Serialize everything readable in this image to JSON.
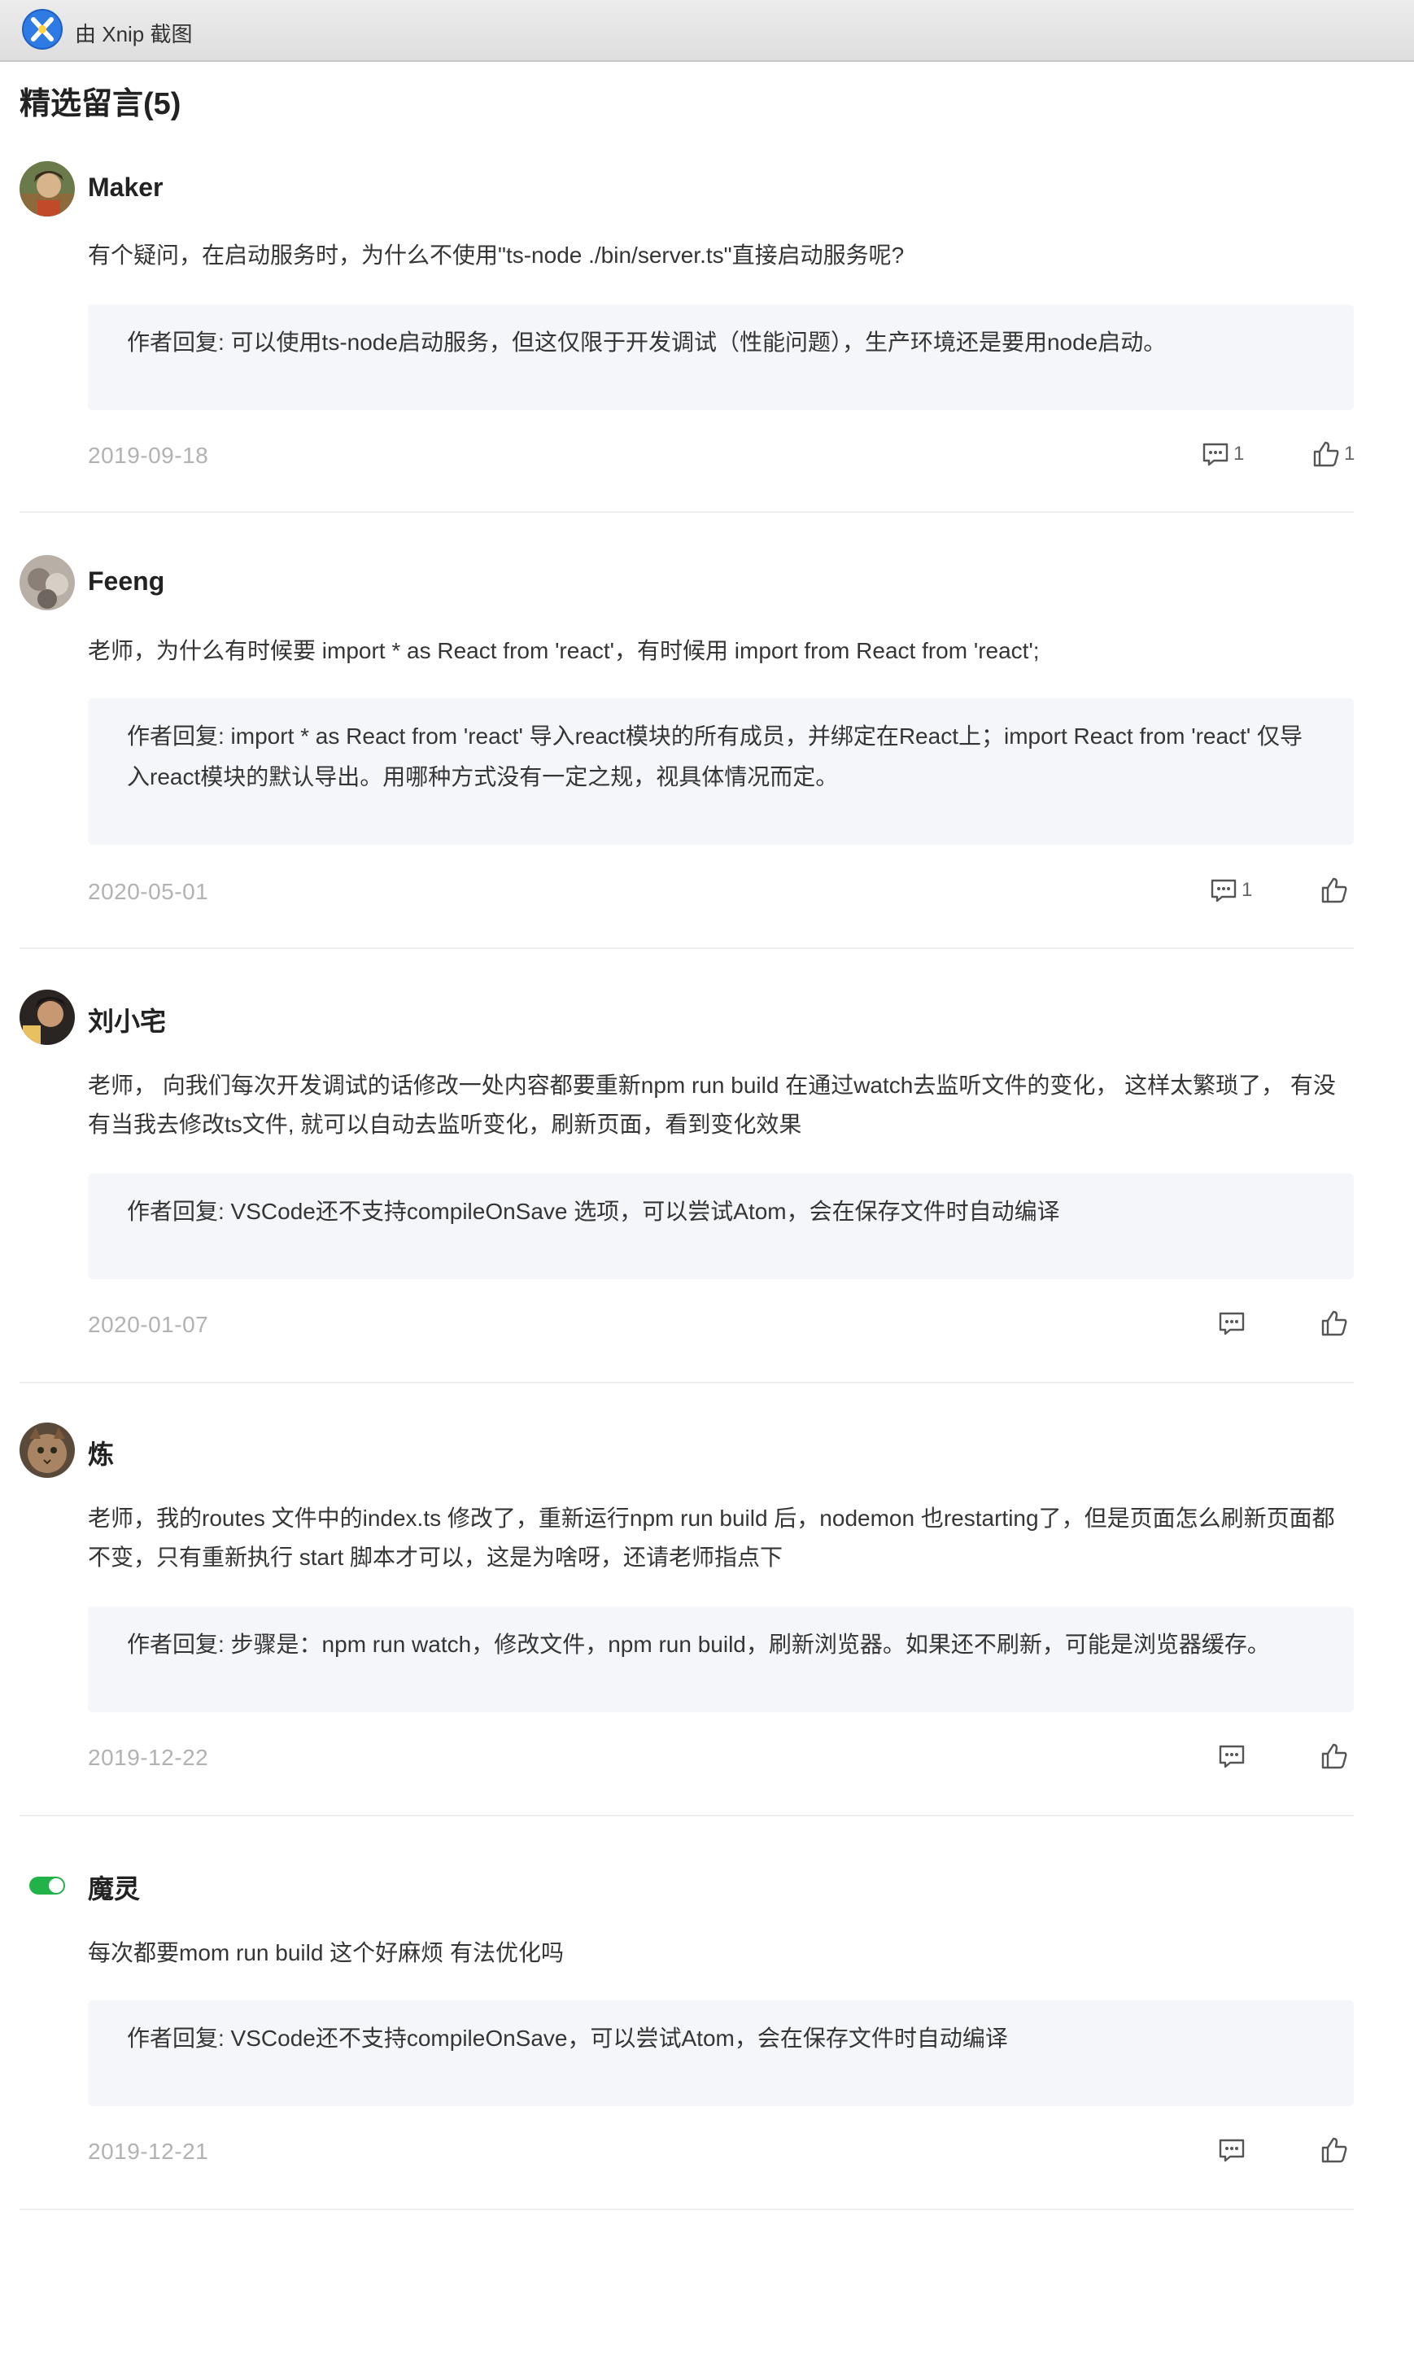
{
  "titlebar": {
    "text": "由 Xnip 截图",
    "icon": "xnip-app-icon"
  },
  "section": {
    "title": "精选留言(5)"
  },
  "comments": [
    {
      "author": "Maker",
      "avatar": "avatar-photo",
      "text": "有个疑问，在启动服务时，为什么不使用\"ts-node ./bin/server.ts\"直接启动服务呢?",
      "reply_label": "作者回复:",
      "reply": " 可以使用ts-node启动服务，但这仅限于开发调试（性能问题），生产环境还是要用node启动。",
      "date": "2019-09-18",
      "reply_count": "1",
      "like_count": "1"
    },
    {
      "author": "Feeng",
      "avatar": "avatar-photo",
      "text": "老师，为什么有时候要 import * as React from 'react'，有时候用 import from React from 'react';",
      "reply_label": "作者回复:",
      "reply": " import * as React from 'react' 导入react模块的所有成员，并绑定在React上；import React from 'react' 仅导入react模块的默认导出。用哪种方式没有一定之规，视具体情况而定。",
      "date": "2020-05-01",
      "reply_count": "1",
      "like_count": ""
    },
    {
      "author": "刘小宅",
      "avatar": "avatar-photo",
      "text": "老师， 向我们每次开发调试的话修改一处内容都要重新npm run build 在通过watch去监听文件的变化， 这样太繁琐了， 有没有当我去修改ts文件, 就可以自动去监听变化，刷新页面，看到变化效果",
      "reply_label": "作者回复:",
      "reply": " VSCode还不支持compileOnSave 选项，可以尝试Atom，会在保存文件时自动编译",
      "date": "2020-01-07",
      "reply_count": "",
      "like_count": ""
    },
    {
      "author": "炼",
      "avatar": "avatar-photo",
      "text": "老师，我的routes 文件中的index.ts 修改了，重新运行npm run build 后，nodemon 也restarting了，但是页面怎么刷新页面都不变，只有重新执行 start 脚本才可以，这是为啥呀，还请老师指点下",
      "reply_label": "作者回复:",
      "reply": " 步骤是：npm run watch，修改文件，npm run build，刷新浏览器。如果还不刷新，可能是浏览器缓存。",
      "date": "2019-12-22",
      "reply_count": "",
      "like_count": ""
    },
    {
      "author": "魔灵",
      "avatar": "toggle-avatar",
      "text": "每次都要mom run build 这个好麻烦 有法优化吗",
      "reply_label": "作者回复:",
      "reply": " VSCode还不支持compileOnSave，可以尝试Atom，会在保存文件时自动编译",
      "date": "2019-12-21",
      "reply_count": "",
      "like_count": ""
    }
  ],
  "colors": {
    "reply_bg": "#f5f6fa",
    "date": "#b2b2b2",
    "toggle_green": "#21b24a",
    "xnip_blue": "#2e7be6"
  }
}
